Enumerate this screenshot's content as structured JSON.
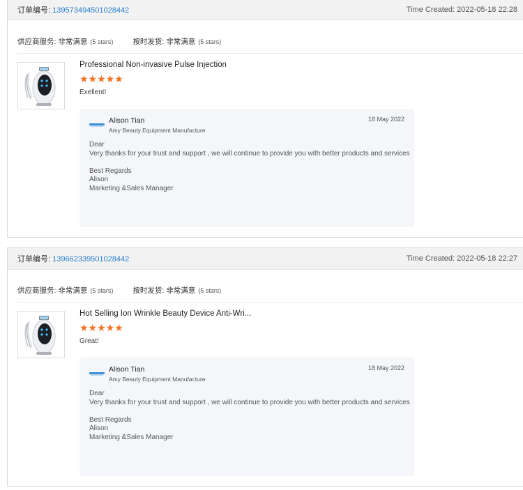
{
  "orders": [
    {
      "order_label": "订单编号:",
      "order_number": "139573494501028442",
      "time_created": "Time Created: 2022-05-18 22:28",
      "supplier_service_label": "供应商服务: 非常满意",
      "supplier_service_stars": "(5 stars)",
      "delivery_label": "按时发货: 非常满意",
      "delivery_stars": "(5 stars)",
      "product_title": "Professional Non-invasive Pulse Injection",
      "rating_stars": "★★★★★",
      "rating_value": 5,
      "comment": "Exellent!",
      "reply": {
        "name": "Alison Tian",
        "company": "Amy Beauty Equipment Manufacture",
        "date": "18 May 2022",
        "body": "Dear\nVery thanks for your trust and support , we will continue to provide you with better products and services\n\nBest Regards\nAlison\nMarketing &Sales Manager"
      }
    },
    {
      "order_label": "订单编号:",
      "order_number": "139662339501028442",
      "time_created": "Time Created: 2022-05-18 22:27",
      "supplier_service_label": "供应商服务: 非常满意",
      "supplier_service_stars": "(5 stars)",
      "delivery_label": "按时发货: 非常满意",
      "delivery_stars": "(5 stars)",
      "product_title": "Hot Selling Ion Wrinkle Beauty Device Anti-Wri...",
      "rating_stars": "★★★★★",
      "rating_value": 5,
      "comment": "Great!",
      "reply": {
        "name": "Alison Tian",
        "company": "Amy Beauty Equipment Manufacture",
        "date": "18 May 2022",
        "body": "Dear\nVery thanks for your trust and support , we will continue to provide you with better products and services\n\nBest Regards\nAlison\nMarketing &Sales Manager"
      }
    }
  ],
  "colors": {
    "star": "#f5701f",
    "link": "#2b7fd0",
    "header_bg": "#f2f2f2",
    "reply_bg": "#f4f6f9"
  },
  "icons": {
    "product": "beauty-device-image",
    "company_logo": "company-logo-icon"
  }
}
